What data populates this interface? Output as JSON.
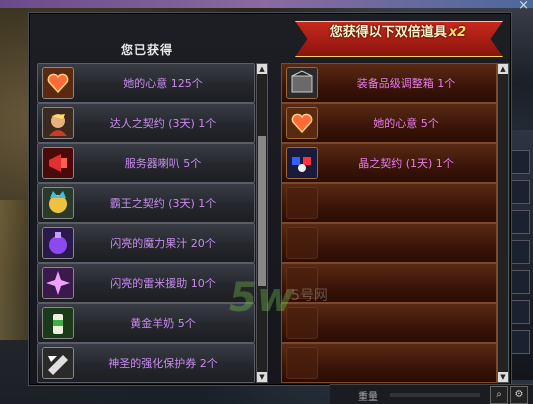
{
  "window": {
    "received_title": "您已获得",
    "double_banner": "您获得以下双倍道具",
    "double_multiplier": "x2",
    "close_symbol": "×"
  },
  "received_items": [
    {
      "label": "她的心意 125个",
      "icon": "heart-icon"
    },
    {
      "label": "达人之契约 (3天) 1个",
      "icon": "expert-contract-icon"
    },
    {
      "label": "服务器喇叭 5个",
      "icon": "megaphone-icon"
    },
    {
      "label": "霸王之契约 (3天) 1个",
      "icon": "overlord-contract-icon"
    },
    {
      "label": "闪亮的魔力果汁 20个",
      "icon": "magic-juice-icon"
    },
    {
      "label": "闪亮的雷米援助 10个",
      "icon": "remy-aid-icon"
    },
    {
      "label": "黄金羊奶 5个",
      "icon": "goat-milk-icon"
    },
    {
      "label": "神圣的强化保护券 2个",
      "icon": "enhance-ticket-icon"
    }
  ],
  "double_items": [
    {
      "label": "装备品级调整箱 1个",
      "icon": "grade-box-icon"
    },
    {
      "label": "她的心意 5个",
      "icon": "heart-icon"
    },
    {
      "label": "晶之契约 (1天) 1个",
      "icon": "crystal-contract-icon"
    },
    {
      "label": "",
      "icon": "empty-slot"
    },
    {
      "label": "",
      "icon": "empty-slot"
    },
    {
      "label": "",
      "icon": "empty-slot"
    },
    {
      "label": "",
      "icon": "empty-slot"
    },
    {
      "label": "",
      "icon": "empty-slot"
    }
  ],
  "watermark": {
    "logo": "5w",
    "site": "5号网"
  },
  "bottom_bar": {
    "label": "重量"
  },
  "colors": {
    "item_text": "#d060f0",
    "banner": "#c8281c"
  }
}
